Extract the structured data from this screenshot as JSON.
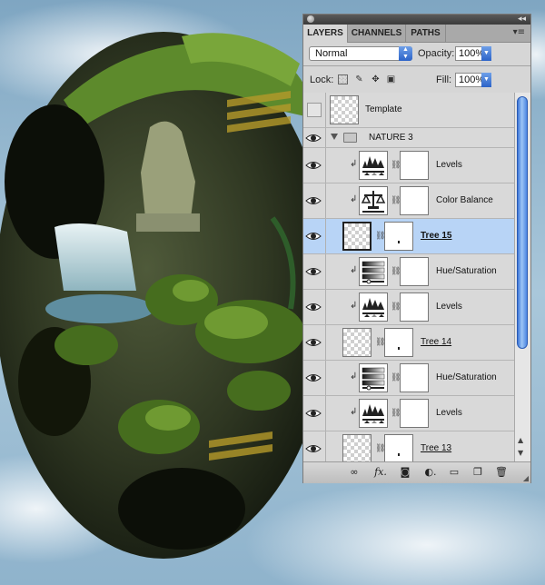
{
  "tabs": [
    "LAYERS",
    "CHANNELS",
    "PATHS"
  ],
  "blend_mode": "Normal",
  "opacity_label": "Opacity:",
  "opacity_value": "100%",
  "lock_label": "Lock:",
  "fill_label": "Fill:",
  "fill_value": "100%",
  "layers": [
    {
      "name": "Template",
      "visible": false,
      "kind": "plain"
    },
    {
      "name": "NATURE 3",
      "visible": true,
      "kind": "group"
    },
    {
      "name": "Levels",
      "visible": true,
      "kind": "adjustment",
      "icon": "levels-icon"
    },
    {
      "name": "Color Balance",
      "visible": true,
      "kind": "adjustment",
      "icon": "color-balance-icon"
    },
    {
      "name": "Tree 15",
      "visible": true,
      "kind": "smart",
      "selected": true
    },
    {
      "name": "Hue/Saturation",
      "visible": true,
      "kind": "adjustment",
      "icon": "hue-saturation-icon"
    },
    {
      "name": "Levels",
      "visible": true,
      "kind": "adjustment",
      "icon": "levels-icon"
    },
    {
      "name": "Tree 14",
      "visible": true,
      "kind": "smart"
    },
    {
      "name": "Hue/Saturation",
      "visible": true,
      "kind": "adjustment",
      "icon": "hue-saturation-icon"
    },
    {
      "name": "Levels",
      "visible": true,
      "kind": "adjustment",
      "icon": "levels-icon"
    },
    {
      "name": "Tree 13",
      "visible": true,
      "kind": "smart"
    }
  ],
  "colors": {
    "sky": "#9fc0d6",
    "selection": "#b8d4f6",
    "scroll_accent": "#3d76d8"
  }
}
